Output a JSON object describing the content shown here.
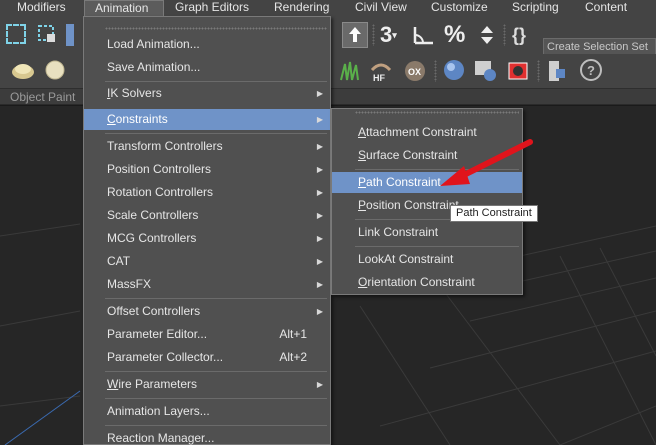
{
  "menubar": {
    "items": [
      {
        "label": "Modifiers"
      },
      {
        "label": "Animation"
      },
      {
        "label": "Graph Editors"
      },
      {
        "label": "Rendering"
      },
      {
        "label": "Civil View"
      },
      {
        "label": "Customize"
      },
      {
        "label": "Scripting"
      },
      {
        "label": "Content"
      }
    ]
  },
  "toolbar": {
    "selection_set_placeholder": "Create Selection Set",
    "snap_label": "3",
    "ribbon_label": "Object Paint"
  },
  "animation_menu": {
    "items": [
      {
        "label": "Load Animation..."
      },
      {
        "label": "Save Animation..."
      },
      {
        "label": "IK Solvers",
        "underline": "I",
        "rest": "K Solvers"
      },
      {
        "label": "Constraints",
        "underline": "C",
        "rest": "onstraints"
      },
      {
        "label": "Transform Controllers"
      },
      {
        "label": "Position Controllers"
      },
      {
        "label": "Rotation Controllers"
      },
      {
        "label": "Scale Controllers"
      },
      {
        "label": "MCG Controllers"
      },
      {
        "label": "CAT"
      },
      {
        "label": "MassFX"
      },
      {
        "label": "Offset Controllers"
      },
      {
        "label": "Parameter Editor...",
        "shortcut": "Alt+1"
      },
      {
        "label": "Parameter Collector...",
        "shortcut": "Alt+2"
      },
      {
        "label": "Wire Parameters",
        "underline": "W",
        "rest": "ire Parameters"
      },
      {
        "label": "Animation Layers..."
      },
      {
        "label": "Reaction Manager..."
      }
    ]
  },
  "constraints_menu": {
    "items": [
      {
        "label": "Attachment Constraint",
        "underline": "A",
        "rest": "ttachment Constraint"
      },
      {
        "label": "Surface Constraint",
        "underline": "S",
        "rest": "urface Constraint"
      },
      {
        "label": "Path Constraint",
        "underline": "P",
        "rest": "ath Constraint"
      },
      {
        "label": "Position Constraint",
        "underline": "P",
        "rest": "osition Constraint"
      },
      {
        "label": "Link Constraint"
      },
      {
        "label": "LookAt Constraint"
      },
      {
        "label": "Orientation Constraint",
        "underline": "O",
        "rest": "rientation Constraint"
      }
    ]
  },
  "tooltip": {
    "text": "Path Constraint"
  },
  "colors": {
    "highlight": "#6f93c8",
    "annotation_arrow": "#e0141c",
    "menu_bg": "#505050"
  }
}
